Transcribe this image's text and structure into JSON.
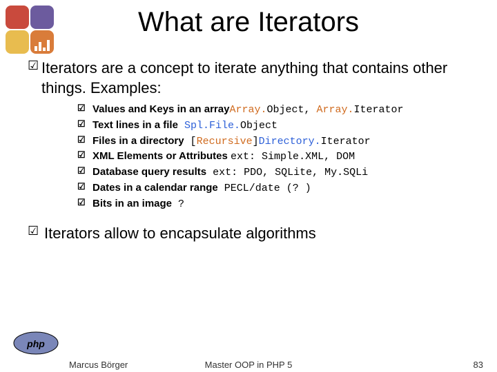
{
  "title": "What are Iterators",
  "intro": "Iterators are a concept to iterate anything that contains other things. Examples:",
  "examples": [
    {
      "label": "Values and Keys in an array",
      "class_parts": [
        {
          "t": "Array.",
          "c": "orange"
        },
        {
          "t": "Object",
          "c": "black"
        },
        {
          "t": ", ",
          "c": "black"
        },
        {
          "t": "Array.",
          "c": "orange"
        },
        {
          "t": "Iterator",
          "c": "black"
        }
      ]
    },
    {
      "label": "Text lines in a file",
      "class_parts": [
        {
          "t": "   ",
          "c": "black"
        },
        {
          "t": "Spl.File.",
          "c": "blue"
        },
        {
          "t": "Object",
          "c": "black"
        }
      ]
    },
    {
      "label": "Files in a directory",
      "class_parts": [
        {
          "t": "  [",
          "c": "black"
        },
        {
          "t": "Recursive",
          "c": "orange"
        },
        {
          "t": "]",
          "c": "black"
        },
        {
          "t": "Directory.",
          "c": "blue"
        },
        {
          "t": "Iterator",
          "c": "black"
        }
      ]
    },
    {
      "label": "XML Elements or Attributes ",
      "class_parts": [
        {
          "t": "ext: Simple.XML, DOM",
          "c": "black"
        }
      ]
    },
    {
      "label": "Database query results",
      "class_parts": [
        {
          "t": "        ext: PDO, SQLite, My.SQLi",
          "c": "black"
        }
      ]
    },
    {
      "label": "Dates in a calendar range",
      "class_parts": [
        {
          "t": "    PECL/date (? )",
          "c": "black"
        }
      ]
    },
    {
      "label": "Bits in an image",
      "class_parts": [
        {
          "t": "     ?",
          "c": "black"
        }
      ]
    }
  ],
  "closing": "Iterators allow to encapsulate algorithms",
  "footer": {
    "author": "Marcus Börger",
    "center": "Master OOP in PHP 5",
    "page": "83"
  }
}
